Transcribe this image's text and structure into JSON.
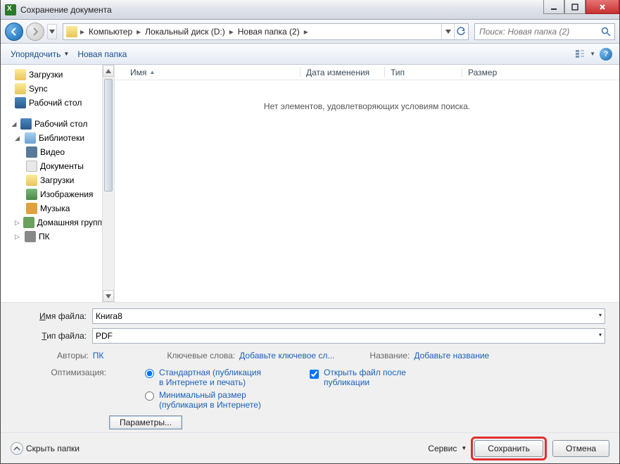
{
  "window": {
    "title": "Сохранение документа"
  },
  "nav": {
    "breadcrumb": [
      "Компьютер",
      "Локальный диск (D:)",
      "Новая папка (2)"
    ],
    "search_placeholder": "Поиск: Новая папка (2)"
  },
  "toolbar": {
    "organize": "Упорядочить",
    "new_folder": "Новая папка"
  },
  "sidebar": {
    "quick": [
      {
        "label": "Загрузки",
        "icon": "folder"
      },
      {
        "label": "Sync",
        "icon": "folder"
      },
      {
        "label": "Рабочий стол",
        "icon": "desktop"
      }
    ],
    "groups": [
      {
        "label": "Рабочий стол",
        "icon": "desktop",
        "children": [
          {
            "label": "Библиотеки",
            "icon": "lib",
            "children": [
              {
                "label": "Видео",
                "icon": "vid"
              },
              {
                "label": "Документы",
                "icon": "doc"
              },
              {
                "label": "Загрузки",
                "icon": "folder"
              },
              {
                "label": "Изображения",
                "icon": "img"
              },
              {
                "label": "Музыка",
                "icon": "mus"
              }
            ]
          },
          {
            "label": "Домашняя групп",
            "icon": "home"
          },
          {
            "label": "ПК",
            "icon": "pc"
          }
        ]
      }
    ]
  },
  "columns": {
    "name": "Имя",
    "date": "Дата изменения",
    "type": "Тип",
    "size": "Размер"
  },
  "empty_message": "Нет элементов, удовлетворяющих условиям поиска.",
  "fields": {
    "filename_label_pre": "Имя файла:",
    "filename_accel": "И",
    "filename_rest": "мя файла:",
    "filename_value": "Книга8",
    "filetype_accel": "Т",
    "filetype_rest": "ип файла:",
    "filetype_value": "PDF"
  },
  "meta": {
    "authors_label": "Авторы:",
    "authors_value": "ПК",
    "keywords_label": "Ключевые слова:",
    "keywords_link": "Добавьте ключевое сл...",
    "title_label": "Название:",
    "title_link": "Добавьте название"
  },
  "options": {
    "label": "Оптимизация:",
    "radio1": "Стандартная (публикация в Интернете и печать)",
    "radio2": "Минимальный размер (публикация в Интернете)",
    "checkbox": "Открыть файл после публикации",
    "params_button": "Параметры..."
  },
  "footer": {
    "hide_folders": "Скрыть папки",
    "tools": "Сервис",
    "save": "Сохранить",
    "cancel": "Отмена"
  }
}
